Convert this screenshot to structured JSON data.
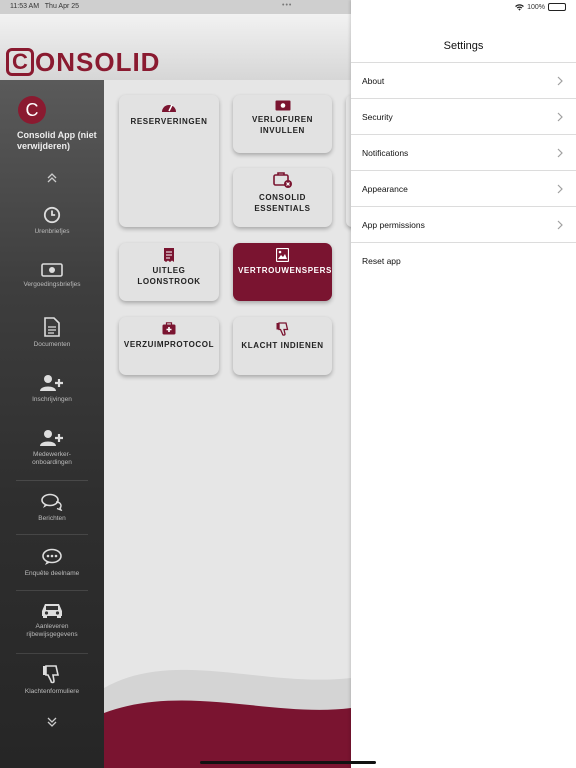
{
  "status_bar": {
    "time": "11:53 AM",
    "date": "Thu Apr 25",
    "dots": "•••",
    "battery": "100%",
    "battery_level": 1.0
  },
  "header": {
    "logo_c": "C",
    "logo_rest": "ONSOLID"
  },
  "sidebar": {
    "avatar_letter": "C",
    "app_name": "Consolid App (niet verwijderen)",
    "items": [
      {
        "label": "Urenbriefjes",
        "icon": "clock-icon"
      },
      {
        "label": "Vergoedingsbriefjes",
        "icon": "money-icon"
      },
      {
        "label": "Documenten",
        "icon": "document-icon"
      },
      {
        "label": "Inschrijvingen",
        "icon": "user-plus-icon"
      },
      {
        "label": "Medewerker-onboardingen",
        "icon": "user-plus-icon"
      },
      {
        "label": "Berichten",
        "icon": "chat-icon"
      },
      {
        "label": "Enquête deelname",
        "icon": "comment-dots-icon"
      },
      {
        "label": "Aanleveren rijbewijsgegevens",
        "icon": "car-icon"
      },
      {
        "label": "Klachtenformuliere",
        "icon": "thumbs-down-icon"
      }
    ]
  },
  "tiles": {
    "reserveringen": "RESERVERINGEN",
    "verlofuren_1": "VERLOFUREN",
    "verlofuren_2": "INVULLEN",
    "essentials_1": "CONSOLID",
    "essentials_2": "ESSENTIALS",
    "loonstrook_1": "UITLEG",
    "loonstrook_2": "LOONSTROOK",
    "vertrouwens": "VERTROUWENSPERSO",
    "verzuim": "VERZUIMPROTOCOL",
    "klacht": "KLACHT INDIENEN"
  },
  "settings": {
    "title": "Settings",
    "items": [
      {
        "label": "About",
        "chevron": true
      },
      {
        "label": "Security",
        "chevron": true
      },
      {
        "label": "Notifications",
        "chevron": true
      },
      {
        "label": "Appearance",
        "chevron": true
      },
      {
        "label": "App permissions",
        "chevron": true
      },
      {
        "label": "Reset app",
        "chevron": false
      }
    ]
  },
  "colors": {
    "brand": "#8a1a30",
    "active_tile": "#7a1430"
  }
}
